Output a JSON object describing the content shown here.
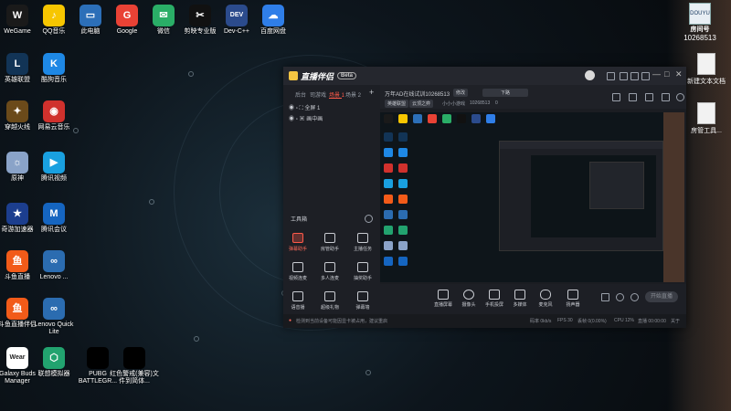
{
  "desktop": {
    "icons": [
      {
        "label": "WeGame",
        "color": "#1a1a1a",
        "glyph": "W"
      },
      {
        "label": "QQ音乐",
        "color": "#f7c600",
        "glyph": "♪"
      },
      {
        "label": "此电脑",
        "color": "#2c6fb8",
        "glyph": "▭"
      },
      {
        "label": "Google",
        "color": "#e94235",
        "glyph": "G"
      },
      {
        "label": "微信",
        "color": "#2aae67",
        "glyph": "✉"
      },
      {
        "label": "剪映专业版",
        "color": "#111111",
        "glyph": "✂"
      },
      {
        "label": "Dev-C++",
        "color": "#2b4b8c",
        "glyph": "DEV"
      },
      {
        "label": "百度网盘",
        "color": "#2f7ee8",
        "glyph": "☁"
      },
      {
        "label": "英雄联盟",
        "color": "#123456",
        "glyph": "L"
      },
      {
        "label": "酷狗音乐",
        "color": "#1e88e5",
        "glyph": "K"
      },
      {
        "label": "穿越火线",
        "color": "#6b4a1a",
        "glyph": "✦"
      },
      {
        "label": "网易云音乐",
        "color": "#d0312d",
        "glyph": "◉"
      },
      {
        "label": "原神",
        "color": "#8aa3c8",
        "glyph": "☼"
      },
      {
        "label": "腾讯视频",
        "color": "#19a0e0",
        "glyph": "▶"
      },
      {
        "label": "奇游加速器",
        "color": "#1c3e8e",
        "glyph": "★"
      },
      {
        "label": "腾讯会议",
        "color": "#1565c0",
        "glyph": "M"
      },
      {
        "label": "斗鱼直播",
        "color": "#f25b19",
        "glyph": "鱼"
      },
      {
        "label": "Lenovo ...",
        "color": "#2b6cb0",
        "glyph": "∞"
      },
      {
        "label": "斗鱼直播伴侣",
        "color": "#f25b19",
        "glyph": "鱼"
      },
      {
        "label": "Lenovo Quick Lite",
        "color": "#2b6cb0",
        "glyph": "∞"
      },
      {
        "label": "Galaxy Buds Manager",
        "color": "#ffffff",
        "glyph": "Wear"
      },
      {
        "label": "联想模拟器",
        "color": "#22a36f",
        "glyph": "⬡"
      },
      {
        "label": "PUBG BATTLEGR...",
        "color": "#000000",
        "glyph": ""
      },
      {
        "label": "红色警戒(兼容)文件到简体...",
        "color": "#000000",
        "glyph": ""
      }
    ],
    "right_docs": [
      {
        "label": "新建文本文档"
      },
      {
        "label": "房管工具..."
      }
    ],
    "room_badge": {
      "title": "房间号",
      "number": "10268513",
      "brand": "DOUYU"
    }
  },
  "app": {
    "name": "直播伴侣",
    "version_badge": "Beta",
    "titlebar_icons": [
      "chat-icon",
      "shirt-icon",
      "gift-icon",
      "settings-icon"
    ],
    "window_controls": [
      "—",
      "□",
      "✕"
    ],
    "scene_tabs": [
      {
        "label": "后台",
        "active": false
      },
      {
        "label": "司游戏",
        "active": false
      },
      {
        "label": "场景 1",
        "active": true
      },
      {
        "label": "场景 2",
        "active": false
      }
    ],
    "add_tab": "+",
    "sources": [
      "全屏 1",
      "画中画"
    ],
    "toolbox_title": "工具箱",
    "tools": [
      {
        "label": "弹幕助手",
        "highlight": true
      },
      {
        "label": "房管助手",
        "highlight": false
      },
      {
        "label": "主播任务",
        "highlight": false
      },
      {
        "label": "视频连麦",
        "highlight": false
      },
      {
        "label": "多人连麦",
        "highlight": false
      },
      {
        "label": "抽奖助手",
        "highlight": false
      },
      {
        "label": "语音播",
        "highlight": false
      },
      {
        "label": "超级礼物",
        "highlight": false
      },
      {
        "label": "弹幕墙",
        "highlight": false
      }
    ],
    "stream_title": "万年AD在线试训10268513",
    "edit_label": "修改",
    "category": "下路",
    "tags": [
      "英雄联盟",
      "云顶之弈"
    ],
    "room_info": "小小小游戏",
    "room_id": "10268513",
    "viewer_count": "0",
    "bottom_tools": [
      "直播屏幕",
      "摄像头",
      "手机投屏",
      "多媒体",
      "麦克风",
      "扬声器"
    ],
    "start_button": "开始直播",
    "status": {
      "message": "检测到当前设备可能因显卡被占用，建议重启",
      "bitrate": "码率 0kb/s",
      "fps": "FPS 30",
      "drop": "丢帧 0(0.00%)",
      "cpu": "CPU 12%",
      "time": "直播 00:00:00",
      "link": "关于"
    }
  }
}
